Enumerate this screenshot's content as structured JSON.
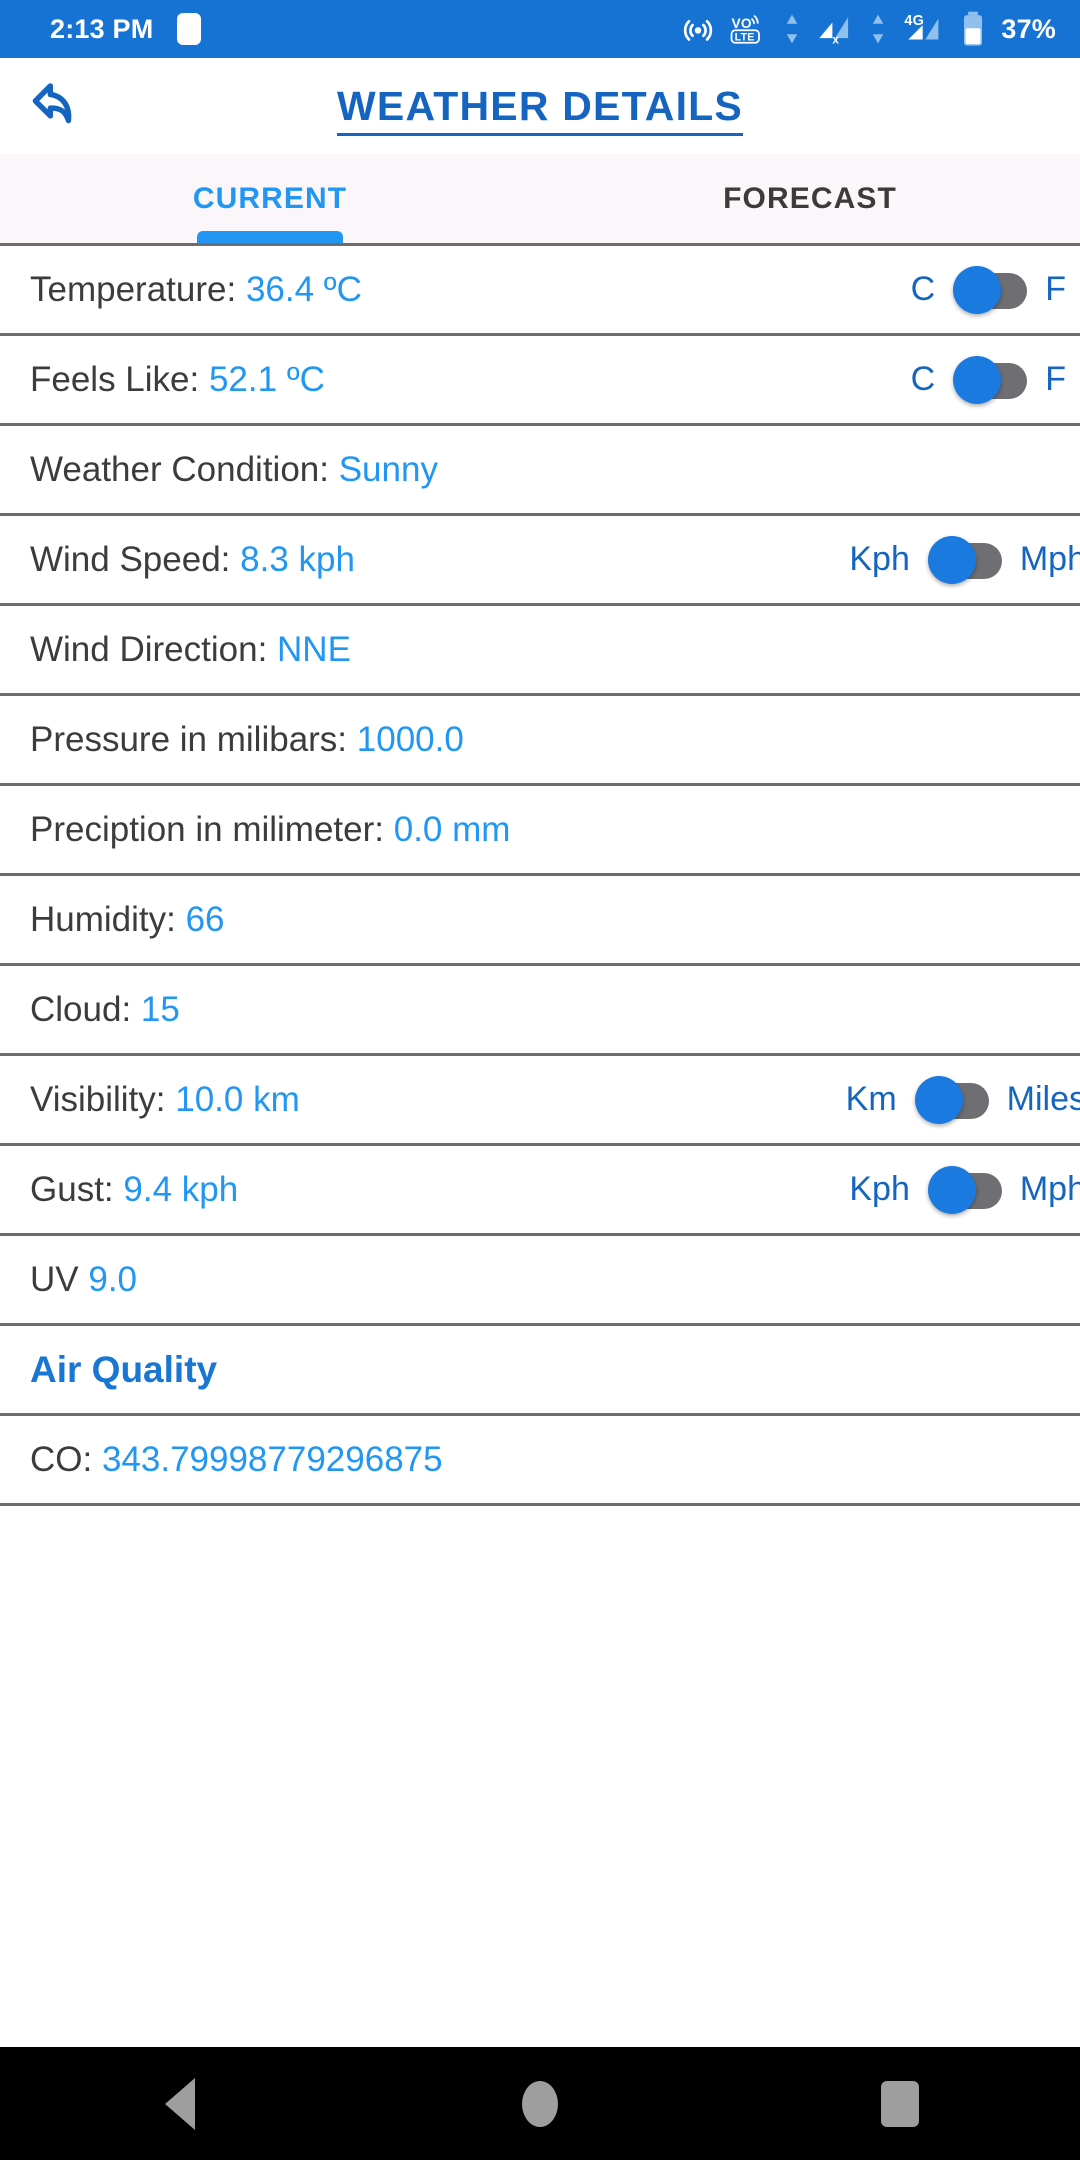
{
  "status_bar": {
    "clock": "2:13 PM",
    "battery_percent": "37%",
    "network_type": "4G",
    "volte_label": "VoLTE",
    "icons": [
      "hotspot-icon",
      "volte-icon",
      "data-transfer-icon",
      "sim1-signal-icon",
      "sim2-signal-icon",
      "battery-icon"
    ],
    "background": "#1773d3"
  },
  "app_bar": {
    "title": "WEATHER DETAILS",
    "back_icon": "reply-back-arrow-icon",
    "title_color": "#1565c0"
  },
  "tabs": {
    "items": [
      {
        "label": "CURRENT",
        "active": true
      },
      {
        "label": "FORECAST",
        "active": false
      }
    ],
    "active_color": "#2196f3",
    "inactive_color": "#3b3b3b",
    "background": "#fbf6fa"
  },
  "rows": [
    {
      "name": "temperature",
      "label": "Temperature: ",
      "value": "36.4 ºC",
      "toggle": {
        "left_label": "C",
        "right_label": "F",
        "state": "left",
        "wide": false
      }
    },
    {
      "name": "feels-like",
      "label": "Feels Like:  ",
      "value": "52.1 ºC",
      "toggle": {
        "left_label": "C",
        "right_label": "F",
        "state": "left",
        "wide": false
      }
    },
    {
      "name": "weather-condition",
      "label": "Weather Condition: ",
      "value": "Sunny",
      "toggle": null
    },
    {
      "name": "wind-speed",
      "label": "Wind Speed: ",
      "value": "8.3 kph",
      "toggle": {
        "left_label": "Kph",
        "right_label": "Mph",
        "state": "left",
        "wide": true
      }
    },
    {
      "name": "wind-direction",
      "label": "Wind Direction: ",
      "value": "NNE",
      "toggle": null
    },
    {
      "name": "pressure",
      "label": "Pressure in milibars: ",
      "value": "1000.0",
      "toggle": null
    },
    {
      "name": "precipitation",
      "label": "Preciption in milimeter: ",
      "value": "0.0 mm",
      "toggle": null
    },
    {
      "name": "humidity",
      "label": "Humidity: ",
      "value": "66",
      "toggle": null
    },
    {
      "name": "cloud",
      "label": "Cloud: ",
      "value": "15",
      "toggle": null
    },
    {
      "name": "visibility",
      "label": "Visibility: ",
      "value": "10.0 km",
      "toggle": {
        "left_label": "Km",
        "right_label": "Miles",
        "state": "left",
        "wide": true
      }
    },
    {
      "name": "gust",
      "label": "Gust: ",
      "value": "9.4 kph",
      "toggle": {
        "left_label": "Kph",
        "right_label": "Mph",
        "state": "left",
        "wide": true
      }
    },
    {
      "name": "uv",
      "label": "UV ",
      "value": "9.0",
      "toggle": null
    },
    {
      "name": "air-quality-header",
      "label": "Air Quality",
      "value": "",
      "section": true,
      "toggle": null
    },
    {
      "name": "co",
      "label": "CO: ",
      "value": "343.79998779296875",
      "toggle": null
    }
  ],
  "nav_bar": {
    "items": [
      {
        "name": "nav-back-button",
        "icon": "triangle-back-icon"
      },
      {
        "name": "nav-home-button",
        "icon": "circle-home-icon"
      },
      {
        "name": "nav-recents-button",
        "icon": "square-recents-icon"
      }
    ],
    "background": "#000000"
  },
  "colors": {
    "primary_blue": "#1773d3",
    "accent_blue": "#2196f3",
    "label_text": "#3c3c3c",
    "divider": "#6d6d6d",
    "toggle_track": "#6e6e73",
    "toggle_thumb": "#1a7ae0"
  }
}
